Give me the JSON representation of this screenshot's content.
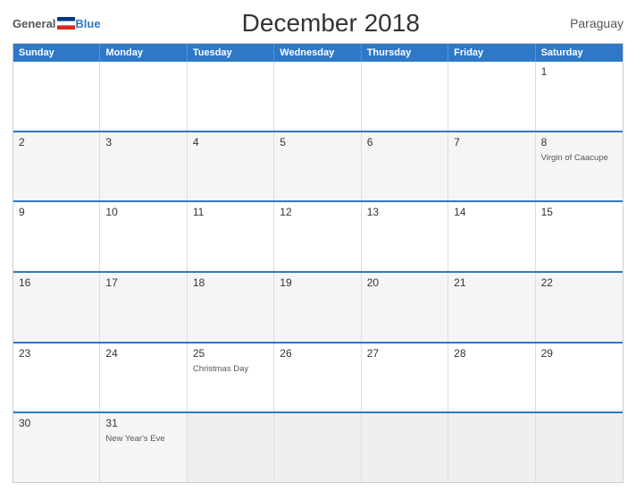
{
  "header": {
    "logo_general": "General",
    "logo_blue": "Blue",
    "title": "December 2018",
    "country": "Paraguay"
  },
  "day_headers": [
    "Sunday",
    "Monday",
    "Tuesday",
    "Wednesday",
    "Thursday",
    "Friday",
    "Saturday"
  ],
  "weeks": [
    [
      {
        "day": "",
        "event": ""
      },
      {
        "day": "",
        "event": ""
      },
      {
        "day": "",
        "event": ""
      },
      {
        "day": "",
        "event": ""
      },
      {
        "day": "",
        "event": ""
      },
      {
        "day": "",
        "event": ""
      },
      {
        "day": "1",
        "event": ""
      }
    ],
    [
      {
        "day": "2",
        "event": ""
      },
      {
        "day": "3",
        "event": ""
      },
      {
        "day": "4",
        "event": ""
      },
      {
        "day": "5",
        "event": ""
      },
      {
        "day": "6",
        "event": ""
      },
      {
        "day": "7",
        "event": ""
      },
      {
        "day": "8",
        "event": "Virgin of Caacupe"
      }
    ],
    [
      {
        "day": "9",
        "event": ""
      },
      {
        "day": "10",
        "event": ""
      },
      {
        "day": "11",
        "event": ""
      },
      {
        "day": "12",
        "event": ""
      },
      {
        "day": "13",
        "event": ""
      },
      {
        "day": "14",
        "event": ""
      },
      {
        "day": "15",
        "event": ""
      }
    ],
    [
      {
        "day": "16",
        "event": ""
      },
      {
        "day": "17",
        "event": ""
      },
      {
        "day": "18",
        "event": ""
      },
      {
        "day": "19",
        "event": ""
      },
      {
        "day": "20",
        "event": ""
      },
      {
        "day": "21",
        "event": ""
      },
      {
        "day": "22",
        "event": ""
      }
    ],
    [
      {
        "day": "23",
        "event": ""
      },
      {
        "day": "24",
        "event": ""
      },
      {
        "day": "25",
        "event": "Christmas Day"
      },
      {
        "day": "26",
        "event": ""
      },
      {
        "day": "27",
        "event": ""
      },
      {
        "day": "28",
        "event": ""
      },
      {
        "day": "29",
        "event": ""
      }
    ],
    [
      {
        "day": "30",
        "event": ""
      },
      {
        "day": "31",
        "event": "New Year's Eve"
      },
      {
        "day": "",
        "event": ""
      },
      {
        "day": "",
        "event": ""
      },
      {
        "day": "",
        "event": ""
      },
      {
        "day": "",
        "event": ""
      },
      {
        "day": "",
        "event": ""
      }
    ]
  ]
}
